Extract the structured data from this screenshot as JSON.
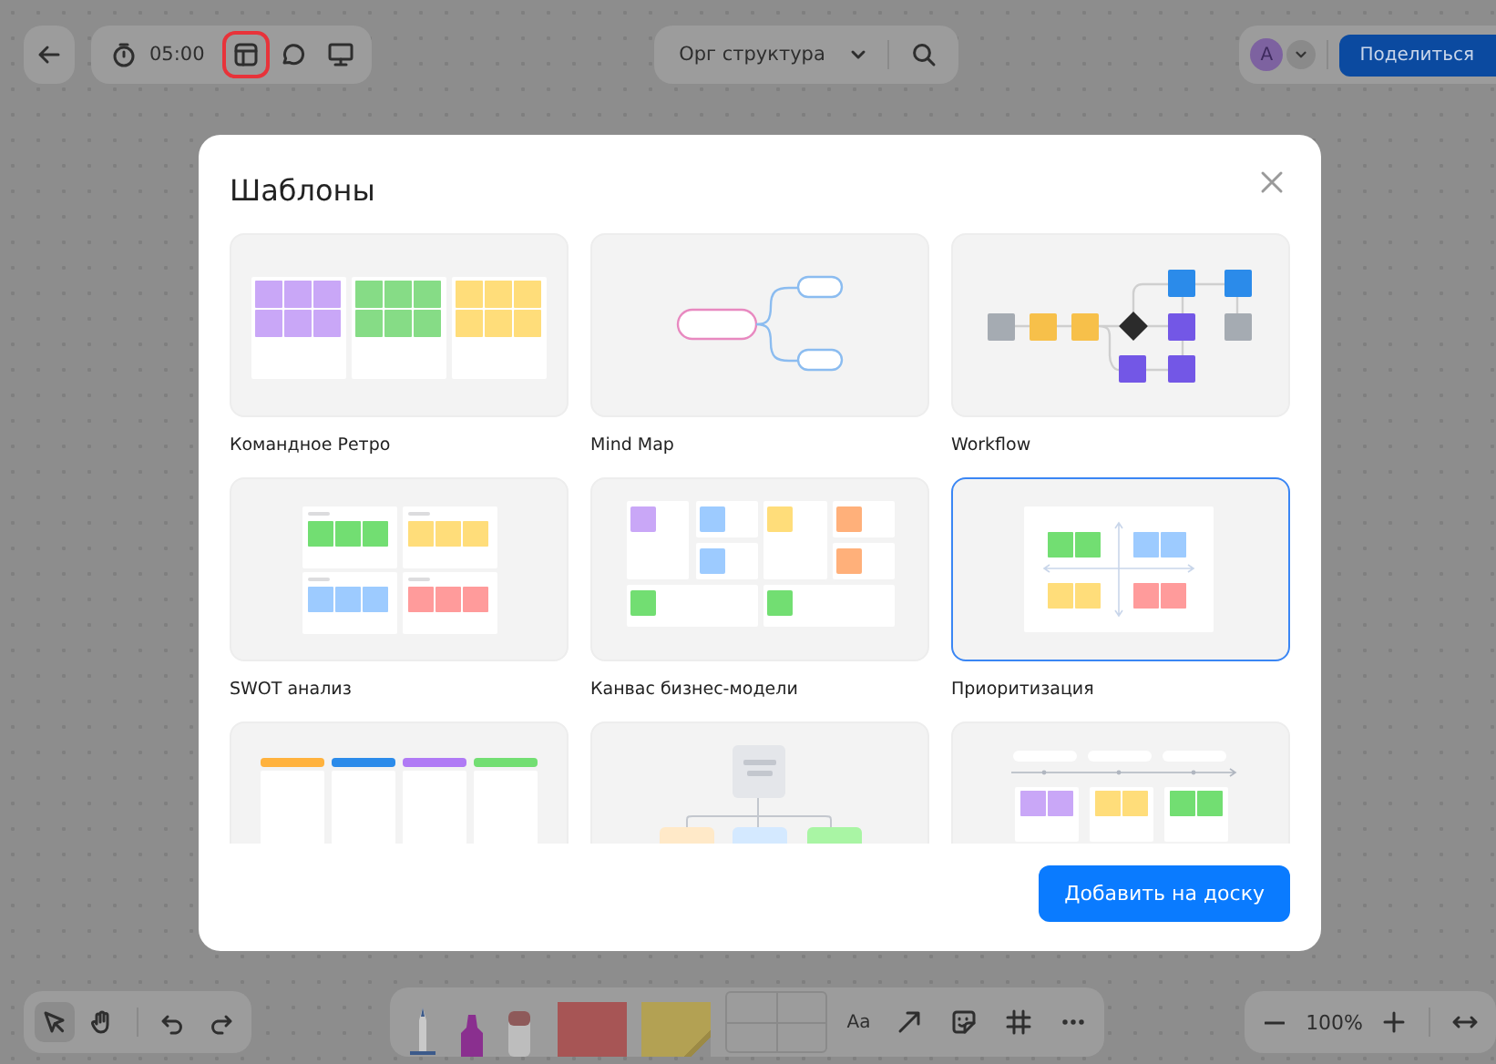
{
  "top_bar": {
    "timer": "05:00",
    "session_tools": [
      {
        "kind": "templates",
        "highlighted": true
      },
      {
        "kind": "comments",
        "highlighted": false
      },
      {
        "kind": "present",
        "highlighted": false
      }
    ],
    "board_title": "Орг структура",
    "avatar": "A",
    "share_button": "Поделиться"
  },
  "bottom_bar": {
    "tools": [
      {
        "kind": "select",
        "selected": true
      },
      {
        "kind": "hand",
        "selected": false
      }
    ],
    "text_tool": "Aa",
    "zoom": "100%"
  },
  "dialog": {
    "title": "Шаблоны",
    "templates": [
      {
        "kind": "retro",
        "name": "Командное Ретро",
        "selected": false
      },
      {
        "kind": "mindmap",
        "name": "Mind Map",
        "selected": false
      },
      {
        "kind": "workflow",
        "name": "Workflow",
        "selected": false
      },
      {
        "kind": "swot",
        "name": "SWOT анализ",
        "selected": false
      },
      {
        "kind": "canvas",
        "name": "Канвас бизнес-модели",
        "selected": false
      },
      {
        "kind": "priority",
        "name": "Приоритизация",
        "selected": true
      },
      {
        "kind": "kanban",
        "selected": false
      },
      {
        "kind": "org",
        "selected": false
      },
      {
        "kind": "timeline",
        "selected": false
      }
    ],
    "add_button": "Добавить на доску"
  }
}
